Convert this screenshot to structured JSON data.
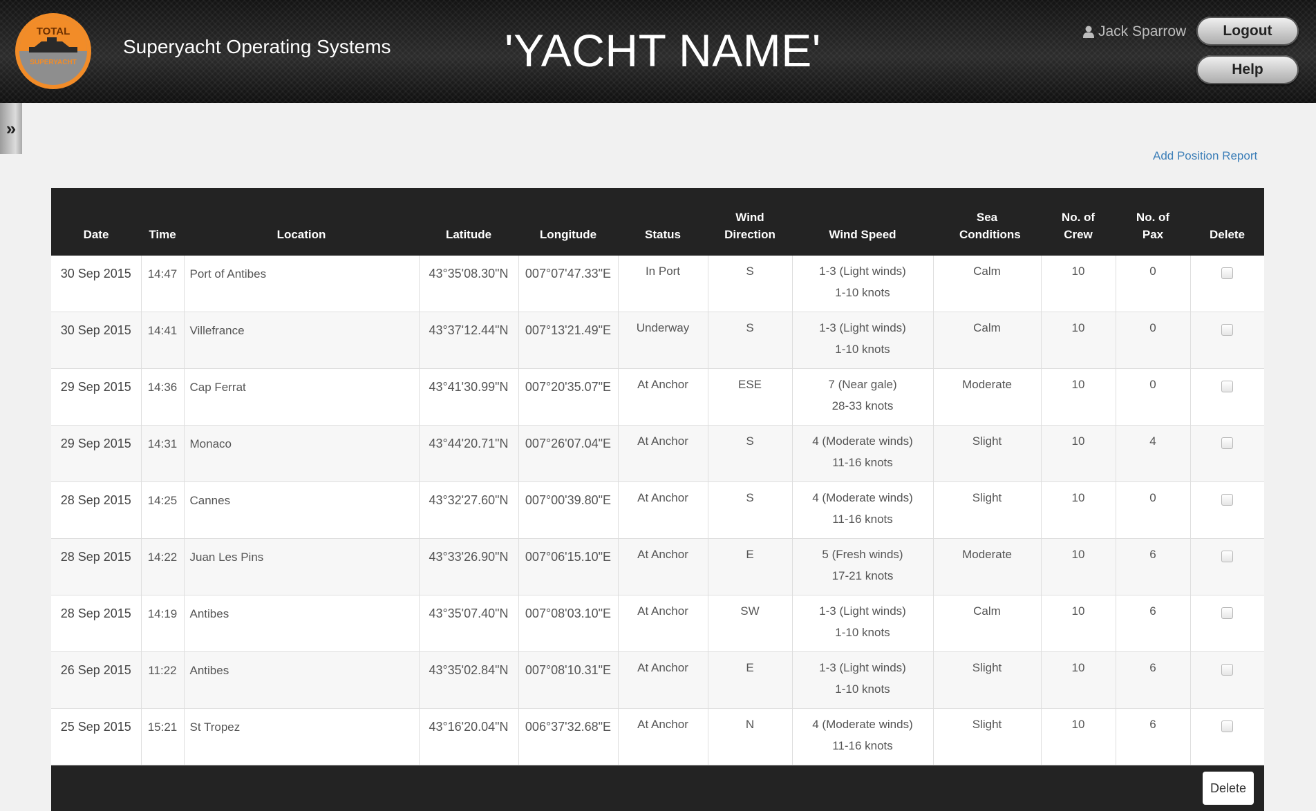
{
  "header": {
    "logo_top_text": "TOTAL",
    "logo_bottom_text": "SUPERYACHT",
    "app_title": "Superyacht Operating Systems",
    "yacht_name": "'YACHT NAME'",
    "user_name": "Jack Sparrow",
    "logout_label": "Logout",
    "help_label": "Help"
  },
  "sidebar": {
    "toggle_glyph": "»"
  },
  "actions": {
    "add_position_report": "Add Position Report"
  },
  "table": {
    "columns": [
      "Date",
      "Time",
      "Location",
      "Latitude",
      "Longitude",
      "Status",
      "Wind Direction",
      "Wind Speed",
      "Sea Conditions",
      "No. of Crew",
      "No. of Pax",
      "Delete"
    ],
    "rows": [
      {
        "date": "30 Sep 2015",
        "time": "14:47",
        "location": "Port of Antibes",
        "lat": "43°35'08.30\"N",
        "lon": "007°07'47.33\"E",
        "status": "In Port",
        "wind_dir": "S",
        "wind_beaufort": "1-3 (Light winds)",
        "wind_knots": "1-10 knots",
        "sea": "Calm",
        "crew": "10",
        "pax": "0"
      },
      {
        "date": "30 Sep 2015",
        "time": "14:41",
        "location": "Villefrance",
        "lat": "43°37'12.44\"N",
        "lon": "007°13'21.49\"E",
        "status": "Underway",
        "wind_dir": "S",
        "wind_beaufort": "1-3 (Light winds)",
        "wind_knots": "1-10 knots",
        "sea": "Calm",
        "crew": "10",
        "pax": "0"
      },
      {
        "date": "29 Sep 2015",
        "time": "14:36",
        "location": "Cap Ferrat",
        "lat": "43°41'30.99\"N",
        "lon": "007°20'35.07\"E",
        "status": "At Anchor",
        "wind_dir": "ESE",
        "wind_beaufort": "7 (Near gale)",
        "wind_knots": "28-33 knots",
        "sea": "Moderate",
        "crew": "10",
        "pax": "0"
      },
      {
        "date": "29 Sep 2015",
        "time": "14:31",
        "location": "Monaco",
        "lat": "43°44'20.71\"N",
        "lon": "007°26'07.04\"E",
        "status": "At Anchor",
        "wind_dir": "S",
        "wind_beaufort": "4 (Moderate winds)",
        "wind_knots": "11-16 knots",
        "sea": "Slight",
        "crew": "10",
        "pax": "4"
      },
      {
        "date": "28 Sep 2015",
        "time": "14:25",
        "location": "Cannes",
        "lat": "43°32'27.60\"N",
        "lon": "007°00'39.80\"E",
        "status": "At Anchor",
        "wind_dir": "S",
        "wind_beaufort": "4 (Moderate winds)",
        "wind_knots": "11-16 knots",
        "sea": "Slight",
        "crew": "10",
        "pax": "0"
      },
      {
        "date": "28 Sep 2015",
        "time": "14:22",
        "location": "Juan Les Pins",
        "lat": "43°33'26.90\"N",
        "lon": "007°06'15.10\"E",
        "status": "At Anchor",
        "wind_dir": "E",
        "wind_beaufort": "5 (Fresh winds)",
        "wind_knots": "17-21 knots",
        "sea": "Moderate",
        "crew": "10",
        "pax": "6"
      },
      {
        "date": "28 Sep 2015",
        "time": "14:19",
        "location": "Antibes",
        "lat": "43°35'07.40\"N",
        "lon": "007°08'03.10\"E",
        "status": "At Anchor",
        "wind_dir": "SW",
        "wind_beaufort": "1-3 (Light winds)",
        "wind_knots": "1-10 knots",
        "sea": "Calm",
        "crew": "10",
        "pax": "6"
      },
      {
        "date": "26 Sep 2015",
        "time": "11:22",
        "location": "Antibes",
        "lat": "43°35'02.84\"N",
        "lon": "007°08'10.31\"E",
        "status": "At Anchor",
        "wind_dir": "E",
        "wind_beaufort": "1-3 (Light winds)",
        "wind_knots": "1-10 knots",
        "sea": "Slight",
        "crew": "10",
        "pax": "6"
      },
      {
        "date": "25 Sep 2015",
        "time": "15:21",
        "location": "St Tropez",
        "lat": "43°16'20.04\"N",
        "lon": "006°37'32.68\"E",
        "status": "At Anchor",
        "wind_dir": "N",
        "wind_beaufort": "4 (Moderate winds)",
        "wind_knots": "11-16 knots",
        "sea": "Slight",
        "crew": "10",
        "pax": "6"
      }
    ]
  },
  "footer": {
    "delete_label": "Delete"
  },
  "colors": {
    "header_bg": "#1c1c1c",
    "table_header_bg": "#232323",
    "link": "#3d7fb8",
    "logo_orange": "#f28c28",
    "logo_grey": "#8e8e8e"
  }
}
